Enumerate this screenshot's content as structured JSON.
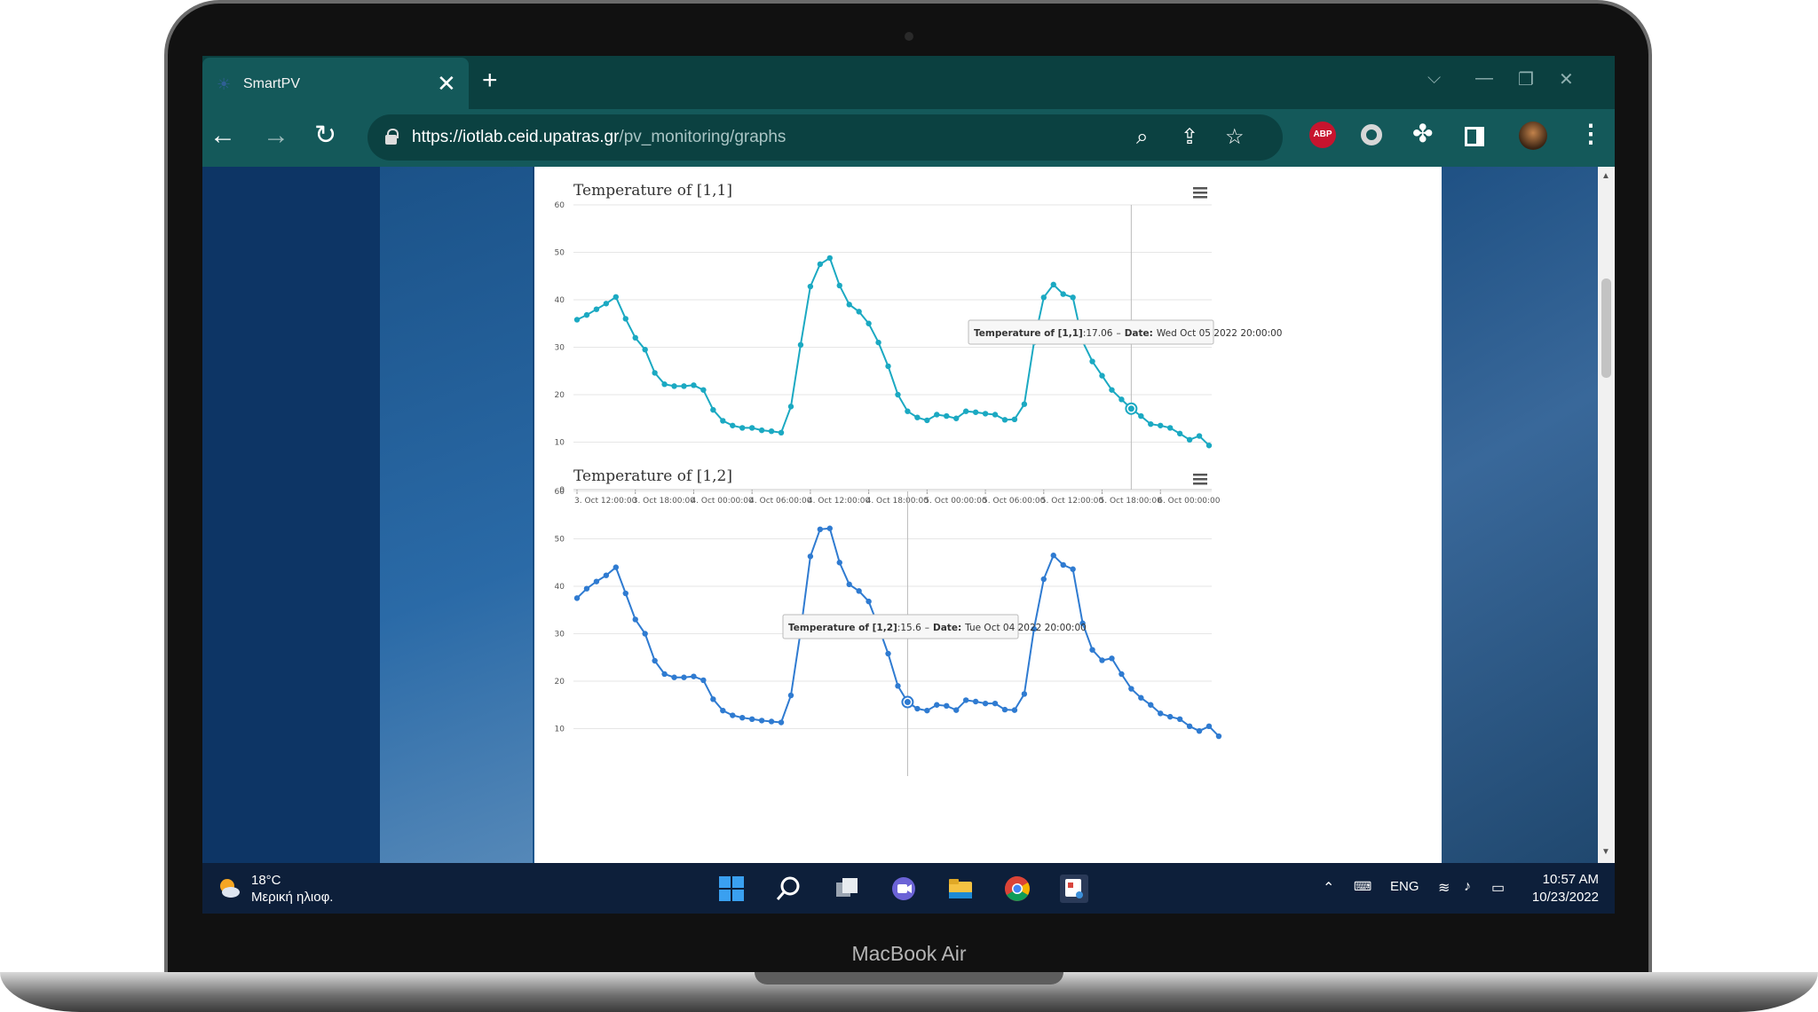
{
  "device": {
    "label": "MacBook Air"
  },
  "browser": {
    "tab_title": "SmartPV",
    "url_host": "https://iotlab.ceid.upatras.gr",
    "url_path": "/pv_monitoring/graphs"
  },
  "page": {
    "charts": [
      {
        "title": "Temperature of [1,1]",
        "tooltip": {
          "series_label": "Temperature of [1,1]",
          "value": ":17.06",
          "date_label": "Date:",
          "date": "Wed Oct 05 2022 20:00:00"
        }
      },
      {
        "title": "Temperature of [1,2]",
        "tooltip": {
          "series_label": "Temperature of [1,2]",
          "value": ":15.6",
          "date_label": "Date:",
          "date": "Tue Oct 04 2022 20:00:00"
        }
      }
    ]
  },
  "chart_data": [
    {
      "type": "line",
      "title": "Temperature of [1,1]",
      "color": "#1ba9c2",
      "x_tick_labels": [
        "3. Oct 12:00:00",
        "3. Oct 18:00:00",
        "4. Oct 00:00:00",
        "4. Oct 06:00:00",
        "4. Oct 12:00:00",
        "4. Oct 18:00:00",
        "5. Oct 00:00:00",
        "5. Oct 06:00:00",
        "5. Oct 12:00:00",
        "5. Oct 18:00:00",
        "6. Oct 00:00:00"
      ],
      "y_ticks": [
        0,
        10,
        20,
        30,
        40,
        50,
        60
      ],
      "ylim": [
        0,
        60
      ],
      "x_start": "2022-10-03 12:00:00",
      "x_step_hours": 1,
      "values": [
        35.8,
        36.8,
        38.0,
        39.2,
        40.6,
        36.0,
        32.0,
        29.5,
        24.6,
        22.2,
        21.8,
        21.8,
        22.0,
        21.0,
        16.8,
        14.5,
        13.5,
        13.0,
        13.0,
        12.5,
        12.3,
        12.0,
        17.5,
        30.5,
        42.8,
        47.5,
        48.8,
        43.0,
        39.0,
        37.5,
        35.0,
        31.0,
        26.0,
        20.0,
        16.5,
        15.2,
        14.6,
        15.8,
        15.5,
        15.0,
        16.5,
        16.3,
        16.0,
        15.8,
        14.7,
        14.8,
        18.0,
        31.0,
        40.5,
        43.2,
        41.2,
        40.5,
        31.2,
        27.0,
        24.0,
        21.0,
        19.0,
        17.06,
        15.5,
        13.8,
        13.5,
        13.0,
        11.8,
        10.5,
        11.3,
        9.3
      ],
      "highlight_index": 57
    },
    {
      "type": "line",
      "title": "Temperature of [1,2]",
      "color": "#2f7bd1",
      "y_ticks": [
        10,
        20,
        30,
        40,
        50,
        60
      ],
      "ylim": [
        0,
        60
      ],
      "x_start": "2022-10-03 12:00:00",
      "x_step_hours": 1,
      "values": [
        37.5,
        39.5,
        41.0,
        42.3,
        44.0,
        38.5,
        33.0,
        30.0,
        24.3,
        21.5,
        20.8,
        20.8,
        21.0,
        20.2,
        16.2,
        13.8,
        12.8,
        12.3,
        12.0,
        11.7,
        11.5,
        11.3,
        17.0,
        30.5,
        46.3,
        52.0,
        52.2,
        45.0,
        40.4,
        39.0,
        36.8,
        31.5,
        25.8,
        19.0,
        15.6,
        14.2,
        13.8,
        15.0,
        14.8,
        13.9,
        16.0,
        15.7,
        15.3,
        15.3,
        14.0,
        13.9,
        17.3,
        31.0,
        41.5,
        46.5,
        44.5,
        43.6,
        32.2,
        26.6,
        24.4,
        24.8,
        21.5,
        18.4,
        16.5,
        15.0,
        13.2,
        12.5,
        12.0,
        10.5,
        9.5,
        10.5,
        8.4
      ],
      "highlight_index": 34
    }
  ],
  "taskbar": {
    "weather_temp": "18°C",
    "weather_desc": "Μερική ηλιοφ.",
    "language": "ENG",
    "time": "10:57 AM",
    "date": "10/23/2022"
  }
}
